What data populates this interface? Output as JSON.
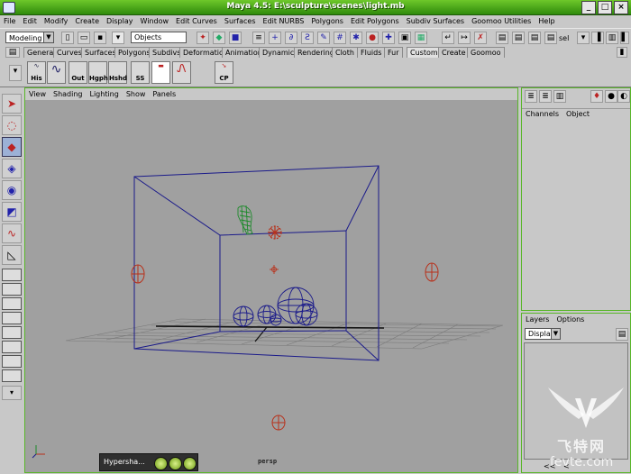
{
  "window": {
    "title": "Maya 4.5: E:\\sculpture\\scenes\\light.mb",
    "minimize": "_",
    "maximize": "□",
    "close": "×"
  },
  "menubar": [
    "File",
    "Edit",
    "Modify",
    "Create",
    "Display",
    "Window",
    "Edit Curves",
    "Surfaces",
    "Edit NURBS",
    "Polygons",
    "Edit Polygons",
    "Subdiv Surfaces",
    "Goomoo Utilities",
    "Help"
  ],
  "toolbar": {
    "mode": "Modeling",
    "selection_field": "Objects",
    "select_label": "sel"
  },
  "shelf_tabs": [
    "General",
    "Curves",
    "Surfaces",
    "Polygons",
    "Subdivs",
    "Deformation",
    "Animation",
    "Dynamics",
    "Rendering",
    "Cloth",
    "Fluids",
    "Fur",
    "Custom",
    "Create",
    "Goomoo"
  ],
  "shelf_active": "Custom",
  "shelf_buttons": [
    "His",
    "",
    "Out",
    "Hgph",
    "Hshd",
    "SS",
    "",
    "",
    "CP"
  ],
  "viewport": {
    "menu": [
      "View",
      "Shading",
      "Lighting",
      "Show",
      "Panels"
    ],
    "camera": "persp"
  },
  "channel_box": {
    "menu": [
      "Channels",
      "Object"
    ]
  },
  "layer_editor": {
    "menu": [
      "Layers",
      "Options"
    ],
    "display_select": "Display",
    "scroll_left": "<<",
    "scroll_more": "<"
  },
  "taskbar": {
    "label": "Hypersha..."
  },
  "watermark": {
    "cn_text": "飞特网",
    "url": "fevte.com"
  },
  "colors": {
    "titlebar": "#3ea512",
    "viewport_bg": "#a0a0a0",
    "wire_blue": "#1a1a8a",
    "light_red": "#b8301a",
    "wire_green": "#1c8a2a"
  }
}
